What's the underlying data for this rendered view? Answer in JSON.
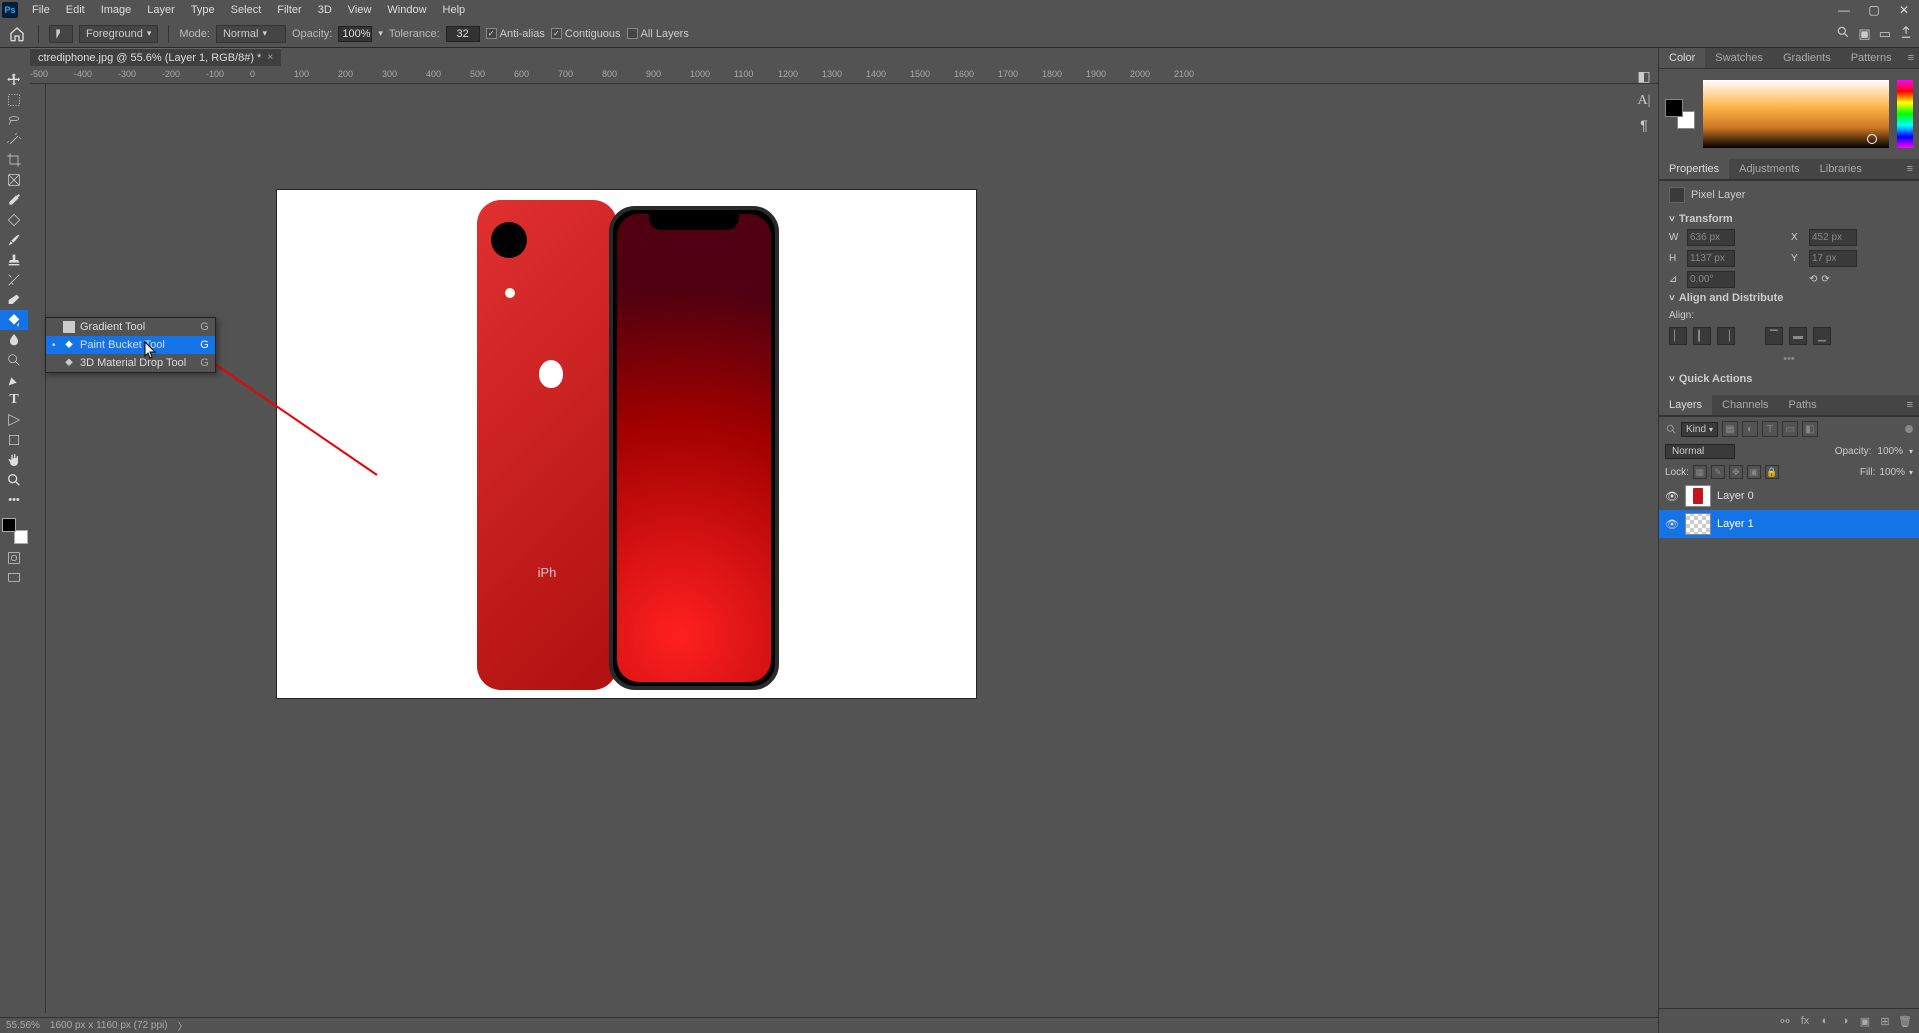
{
  "menu": [
    "File",
    "Edit",
    "Image",
    "Layer",
    "Type",
    "Select",
    "Filter",
    "3D",
    "View",
    "Window",
    "Help"
  ],
  "options": {
    "foreground": "Foreground",
    "mode_label": "Mode:",
    "mode_value": "Normal",
    "opacity_label": "Opacity:",
    "opacity_value": "100%",
    "tolerance_label": "Tolerance:",
    "tolerance_value": "32",
    "antialias": "Anti-alias",
    "contiguous": "Contiguous",
    "all_layers": "All Layers"
  },
  "doc_tab": "ctrediphone.jpg @ 55.6% (Layer 1, RGB/8#) *",
  "ruler_marks": [
    "-500",
    "-400",
    "-300",
    "-200",
    "-100",
    "0",
    "100",
    "200",
    "300",
    "400",
    "500",
    "600",
    "700",
    "800",
    "900",
    "1000",
    "1100",
    "1200",
    "1300",
    "1400",
    "1500",
    "1600",
    "1700",
    "1800",
    "1900",
    "2000",
    "2100"
  ],
  "tool_flyout": [
    {
      "label": "Gradient Tool",
      "shortcut": "G",
      "selected": false
    },
    {
      "label": "Paint Bucket Tool",
      "shortcut": "G",
      "selected": true
    },
    {
      "label": "3D Material Drop Tool",
      "shortcut": "G",
      "selected": false
    }
  ],
  "panels": {
    "color_tabs": [
      "Color",
      "Swatches",
      "Gradients",
      "Patterns"
    ],
    "props_tabs": [
      "Properties",
      "Adjustments",
      "Libraries"
    ],
    "layers_tabs": [
      "Layers",
      "Channels",
      "Paths"
    ]
  },
  "properties": {
    "type": "Pixel Layer",
    "transform": {
      "W": "636 px",
      "X": "452 px",
      "H": "1137 px",
      "Y": "17 px",
      "angle": "0.00°"
    },
    "section_transform": "Transform",
    "section_align": "Align and Distribute",
    "align_label": "Align:",
    "section_quick": "Quick Actions"
  },
  "layers": {
    "kind": "Kind",
    "blend": "Normal",
    "opacity_label": "Opacity:",
    "opacity_value": "100%",
    "lock_label": "Lock:",
    "fill_label": "Fill:",
    "fill_value": "100%",
    "items": [
      {
        "name": "Layer 0",
        "thumb": "image",
        "selected": false
      },
      {
        "name": "Layer 1",
        "thumb": "checker",
        "selected": true
      }
    ]
  },
  "status": {
    "zoom": "55.56%",
    "doc": "1600 px x 1160 px (72 ppi)"
  },
  "canvas_text": "iPh"
}
